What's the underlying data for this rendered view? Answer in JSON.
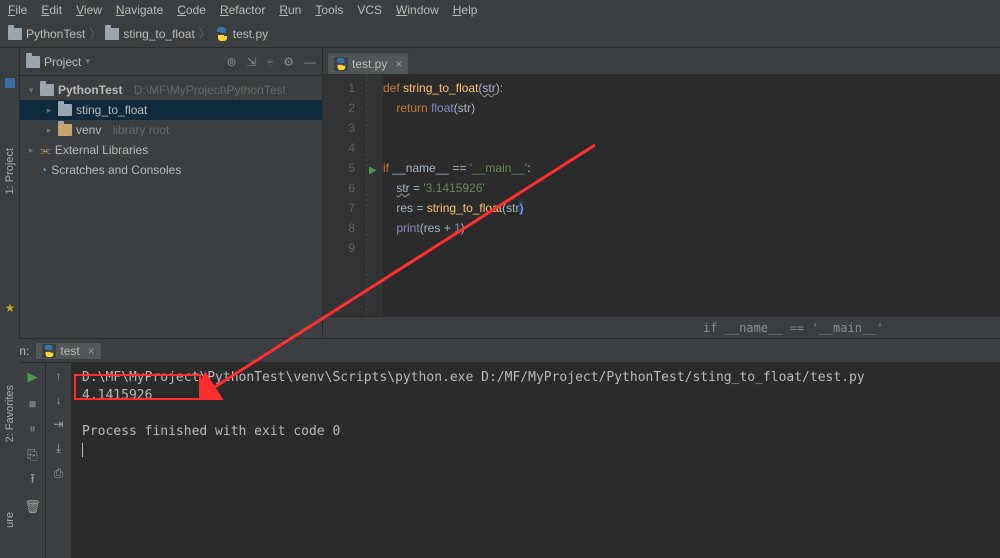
{
  "menubar": {
    "items": [
      "File",
      "Edit",
      "View",
      "Navigate",
      "Code",
      "Refactor",
      "Run",
      "Tools",
      "VCS",
      "Window",
      "Help"
    ]
  },
  "breadcrumb": {
    "root": "PythonTest",
    "folder": "sting_to_float",
    "file": "test.py"
  },
  "project": {
    "title": "Project",
    "tools": {
      "locate": "⊚",
      "collapse": "⇲",
      "divide": "÷",
      "gear": "⚙",
      "hide": "—"
    },
    "root_name": "PythonTest",
    "root_path": "D:\\MF\\MyProject\\PythonTest",
    "items": [
      {
        "name": "sting_to_float",
        "kind": "folder",
        "selected": true
      },
      {
        "name": "venv",
        "suffix": "library root",
        "kind": "folder"
      }
    ],
    "external_libs": "External Libraries",
    "scratches": "Scratches and Consoles"
  },
  "editor": {
    "tab": {
      "name": "test.py"
    },
    "lines": [
      {
        "n": 1,
        "html": "<span class='kw'>def</span> <span class='fn'>string_to_float</span><span>(</span><span class='param uline'>str</span><span>):</span>"
      },
      {
        "n": 2,
        "html": "    <span class='kw'>return</span> <span class='builtin'>float</span><span>(</span><span class='param'>str</span><span>)</span>"
      },
      {
        "n": 3,
        "html": ""
      },
      {
        "n": 4,
        "html": ""
      },
      {
        "n": 5,
        "html": "<span class='kw'>if</span> <span class='var'>__name__</span> <span>==</span> <span class='str'>'__main__'</span><span>:</span>",
        "run_marker": true
      },
      {
        "n": 6,
        "html": "    <span class='var uline'>str</span> <span>=</span> <span class='str'>'3.1415926'</span>"
      },
      {
        "n": 7,
        "html": "    <span class='var'>res</span> <span>=</span> <span class='fn'>string_to_float</span><span>(</span><span class='param'>str</span><span style='background:#214283;'>)</span>"
      },
      {
        "n": 8,
        "html": "    <span class='builtin'>print</span><span>(</span><span class='var'>res</span> <span>+</span> <span class='num'>1</span><span>)</span>"
      },
      {
        "n": 9,
        "html": ""
      }
    ],
    "context": "if __name__ == '__main__'"
  },
  "run": {
    "label": "Run:",
    "tab": "test",
    "console": [
      "D:\\MF\\MyProject\\PythonTest\\venv\\Scripts\\python.exe D:/MF/MyProject/PythonTest/sting_to_float/test.py",
      "4.1415926",
      "",
      "Process finished with exit code 0"
    ]
  },
  "sidebar": {
    "project_label": "1: Project",
    "favorites_label": "2: Favorites",
    "structure_label": "ure"
  }
}
